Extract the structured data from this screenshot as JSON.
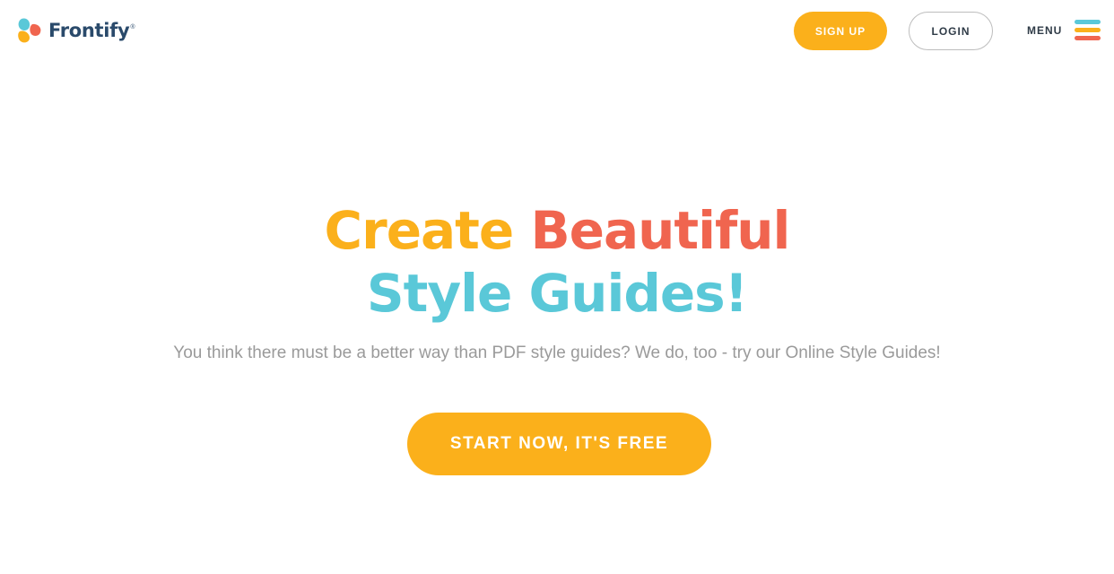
{
  "brand": {
    "name": "Frontify",
    "registered_mark": "®",
    "colors": {
      "orange": "#fbb01b",
      "red": "#f0654f",
      "cyan": "#5ac8d8",
      "navy": "#2a4a6b"
    }
  },
  "header": {
    "logo_icon": "frontify-logo-icon",
    "signup_label": "SIGN UP",
    "login_label": "LOGIN",
    "menu_label": "MENU",
    "menu_icon": "hamburger-icon"
  },
  "hero": {
    "title_word_1": "Create",
    "title_word_2": "Beautiful",
    "title_line_2": "Style Guides!",
    "subtitle": "You think there must be a better way than PDF style guides? We do, too - try our Online Style Guides!",
    "cta_label": "START NOW, IT'S FREE"
  }
}
